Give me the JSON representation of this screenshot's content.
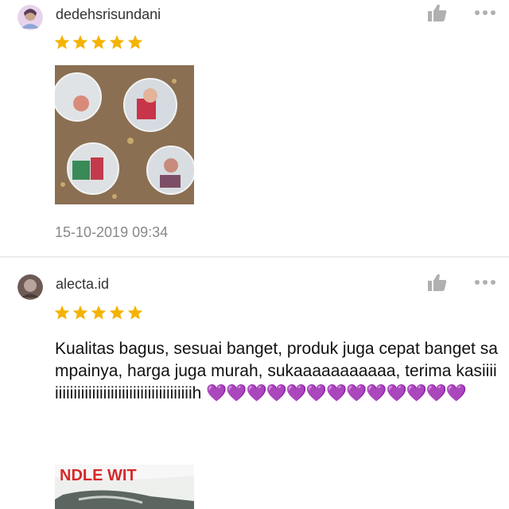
{
  "reviews": [
    {
      "username": "dedehsrisundani",
      "rating": 5,
      "timestamp": "15-10-2019 09:34",
      "avatar_icon": "user-avatar",
      "photo": "product-photo-badges"
    },
    {
      "username": "alecta.id",
      "rating": 5,
      "comment": "Kualitas bagus, sesuai banget, produk juga cepat banget sampainya, harga juga murah, sukaaaaaaaaaaa, terima kasiiiiiiiiiiiiiiiiiiiiiiiiiiiiiiiiiiiiiiiiih",
      "hearts": "💜💜💜💜💜💜💜💜💜💜💜💜💜",
      "avatar_icon": "user-avatar",
      "photo": "product-photo-package"
    }
  ],
  "icons": {
    "like": "thumbs-up-icon",
    "more": "more-options-icon",
    "star": "star-icon"
  },
  "colors": {
    "star": "#f5b301",
    "heart": "#9b3de0",
    "timestamp": "#888888",
    "icon": "#b0b0b0"
  }
}
